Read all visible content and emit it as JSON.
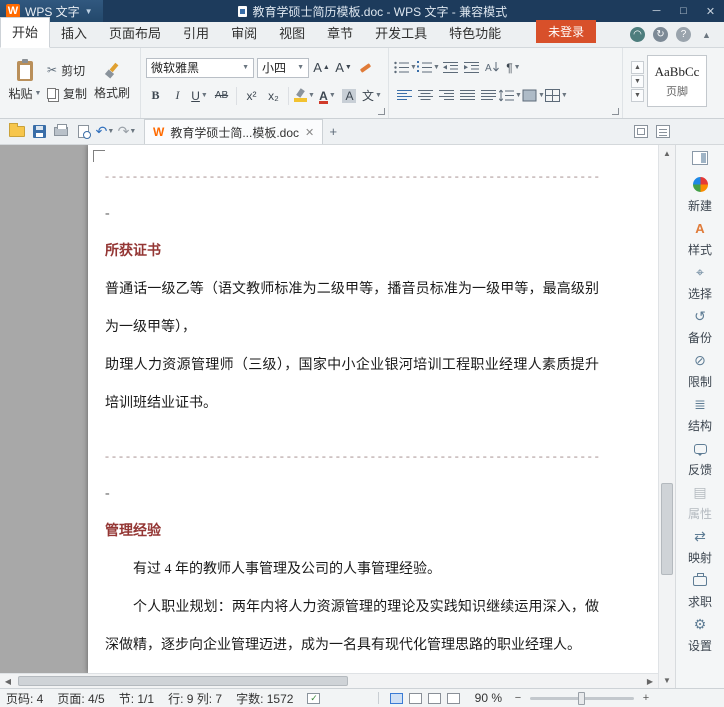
{
  "colors": {
    "titlebar": "#1d3b5c",
    "login_button": "#d8502a",
    "document_heading": "#943634",
    "page_background": "#ffffff",
    "workspace_background": "#a8a8a8"
  },
  "titlebar": {
    "app_name": "WPS 文字",
    "doc_title": "教育学硕士简历模板.doc - WPS 文字 - 兼容模式"
  },
  "menubar": {
    "tabs": [
      "开始",
      "插入",
      "页面布局",
      "引用",
      "审阅",
      "视图",
      "章节",
      "开发工具",
      "特色功能"
    ],
    "active_tab": "开始",
    "login_button": "未登录"
  },
  "ribbon": {
    "paste": "粘贴",
    "cut": "剪切",
    "copy": "复制",
    "format_painter": "格式刷",
    "font_name": "微软雅黑",
    "font_size": "小四",
    "glyphs": {
      "bold": "B",
      "italic": "I",
      "underline": "U",
      "strikethrough": "AB",
      "superscript": "x²",
      "subscript": "x₂",
      "font_color": "A",
      "char_shading": "A",
      "pinyin": "文"
    },
    "style_gallery": {
      "preview": "AaBbCc",
      "name": "页脚"
    }
  },
  "doc_toolbar": {
    "tab_title": "教育学硕士简...模板.doc"
  },
  "document": {
    "separator": "------------------------------------------------------------------------------------------",
    "dash": "-",
    "sections": [
      {
        "heading": "所获证书",
        "paragraphs": [
          "普通话一级乙等（语文教师标准为二级甲等，播音员标准为一级甲等，最高级别为一级甲等），",
          "助理人力资源管理师（三级），国家中小企业银河培训工程职业经理人素质提升培训班结业证书。"
        ]
      },
      {
        "heading": "管理经验",
        "paragraphs": [
          "有过 4 年的教师人事管理及公司的人事管理经验。",
          "个人职业规划：两年内将人力资源管理的理论及实践知识继续运用深入，做深做精，逐步向企业管理迈进，成为一名具有现代化管理思路的职业经理人。"
        ]
      }
    ]
  },
  "sidebar": {
    "items": [
      "新建",
      "样式",
      "选择",
      "备份",
      "限制",
      "结构",
      "反馈",
      "属性",
      "映射",
      "求职",
      "设置"
    ]
  },
  "statusbar": {
    "page": "页码: 4",
    "pages": "页面: 4/5",
    "section": "节: 1/1",
    "line_col": "行: 9 列: 7",
    "words": "字数: 1572",
    "zoom": "90 %"
  }
}
